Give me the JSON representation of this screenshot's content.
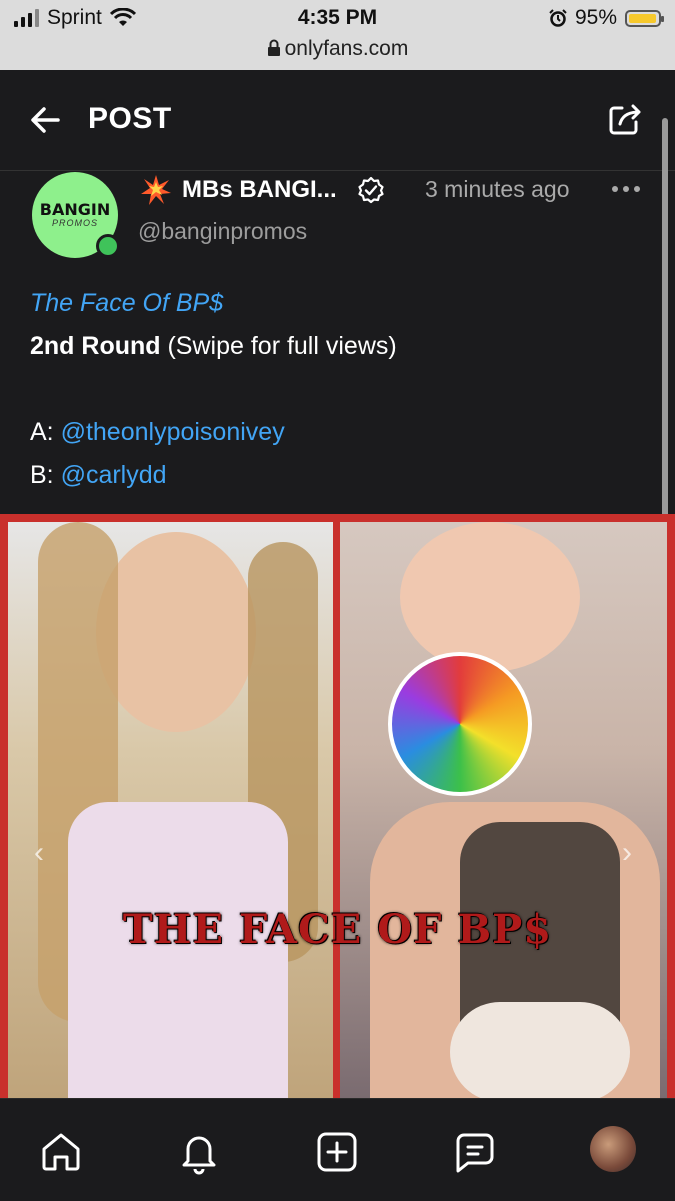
{
  "status_bar": {
    "carrier": "Sprint",
    "time": "4:35 PM",
    "url": "onlyfans.com",
    "battery": "95%",
    "battery_level": 0.95
  },
  "header": {
    "title": "POST"
  },
  "post": {
    "author_name": "MBs BANGI...",
    "author_handle": "@banginpromos",
    "timestamp": "3 minutes ago",
    "avatar_text_main": "BANGIN",
    "avatar_text_sub": "PROMOS",
    "title_link": "The Face Of BP$",
    "round_bold": "2nd Round",
    "round_rest": " (Swipe for full views)",
    "option_a_label": "A: ",
    "option_a_link": "@theonlypoisonivey",
    "option_b_label": "B: ",
    "option_b_link": "@carlydd",
    "image_overlay_text": "THE FACE OF BP$"
  },
  "icons": {
    "back": "arrow-left-icon",
    "share": "share-icon",
    "verified": "verified-badge-icon",
    "more": "more-horizontal-icon",
    "home": "home-icon",
    "notifications": "bell-icon",
    "create": "plus-square-icon",
    "messages": "message-icon"
  },
  "colors": {
    "background": "#1b1b1d",
    "link": "#42a5f5",
    "image_border": "#c9302c",
    "online": "#3fc35a"
  }
}
